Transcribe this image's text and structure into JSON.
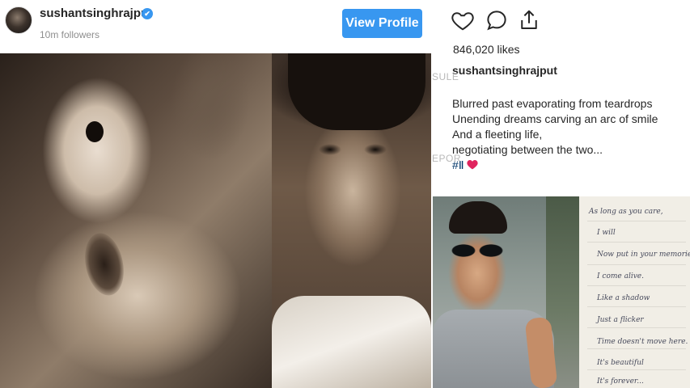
{
  "header": {
    "username": "sushantsinghrajput",
    "verified_badge": "✔",
    "followers": "10m followers",
    "view_profile_label": "View Profile"
  },
  "colors": {
    "accent": "#3897f0",
    "heart": "#e0245e",
    "text": "#262626",
    "muted": "#8e8e8e"
  },
  "actions": {
    "icons": [
      "heart-icon",
      "comment-icon",
      "share-icon"
    ]
  },
  "post": {
    "likes": "846,020 likes",
    "caption_user": "sushantsinghrajput",
    "caption_lines": [
      "Blurred past evaporating from teardrops",
      "Unending dreams carving an arc of smile",
      "And a fleeting life,",
      "negotiating between the two..."
    ],
    "hashtag": "#Ⅱ"
  },
  "watermarks": {
    "top": "SULE",
    "middle": "EPOR"
  },
  "note_lines": [
    "As long as you care,",
    "I will",
    "Now put in your memories",
    "I come alive.",
    "Like a shadow",
    "Just a flicker",
    "Time doesn't move here.",
    "It's beautiful",
    "It's forever..."
  ]
}
